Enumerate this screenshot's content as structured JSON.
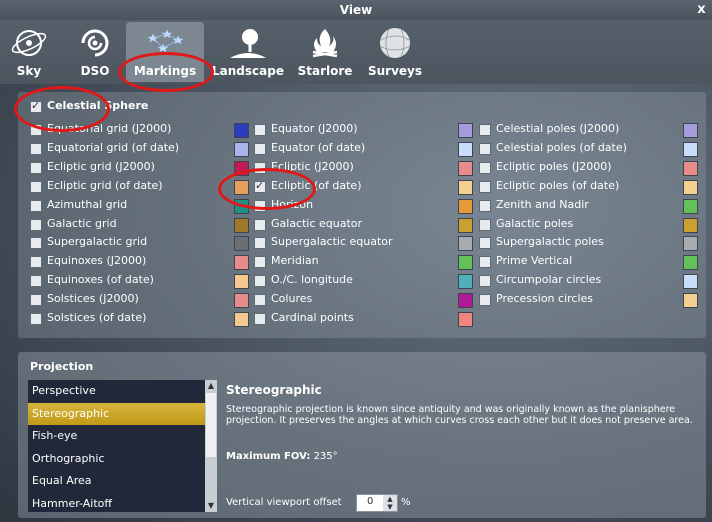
{
  "window": {
    "title": "View",
    "close": "x"
  },
  "tabs": [
    {
      "label": "Sky",
      "icon": "sky-icon"
    },
    {
      "label": "DSO",
      "icon": "dso-icon"
    },
    {
      "label": "Markings",
      "icon": "markings-icon"
    },
    {
      "label": "Landscape",
      "icon": "landscape-icon"
    },
    {
      "label": "Starlore",
      "icon": "starlore-icon"
    },
    {
      "label": "Surveys",
      "icon": "surveys-icon"
    }
  ],
  "active_tab": "Markings",
  "markings": {
    "header": "Celestial Sphere",
    "header_checked": true,
    "col1": [
      {
        "label": "Equatorial grid (J2000)",
        "color": "#2a3bbf"
      },
      {
        "label": "Equatorial grid (of date)",
        "color": "#aab3ea"
      },
      {
        "label": "Ecliptic grid (J2000)",
        "color": "#c21a55"
      },
      {
        "label": "Ecliptic grid (of date)",
        "color": "#e3a05a"
      },
      {
        "label": "Azimuthal grid",
        "color": "#1f8f84"
      },
      {
        "label": "Galactic grid",
        "color": "#a07a2a"
      },
      {
        "label": "Supergalactic grid",
        "color": "#6b6f74"
      },
      {
        "label": "Equinoxes (J2000)",
        "color": "#e88b8b"
      },
      {
        "label": "Equinoxes (of date)",
        "color": "#f3c98f"
      },
      {
        "label": "Solstices (J2000)",
        "color": "#e88b8b"
      },
      {
        "label": "Solstices (of date)",
        "color": "#f3c98f"
      }
    ],
    "col2": [
      {
        "label": "Equator (J2000)",
        "color": "#a79cdb"
      },
      {
        "label": "Equator (of date)",
        "color": "#c9defa"
      },
      {
        "label": "Ecliptic (J2000)",
        "color": "#e88b8b"
      },
      {
        "label": "Ecliptic (of date)",
        "color": "#f3d08f",
        "checked": true
      },
      {
        "label": "Horizon",
        "color": "#e59a3a"
      },
      {
        "label": "Galactic equator",
        "color": "#cba032"
      },
      {
        "label": "Supergalactic equator",
        "color": "#a9acae"
      },
      {
        "label": "Meridian",
        "color": "#64c15a"
      },
      {
        "label": "O./C. longitude",
        "color": "#4fb0b8"
      },
      {
        "label": "Colures",
        "color": "#b01a96"
      },
      {
        "label": "Cardinal points",
        "color": "#f0847f"
      }
    ],
    "col3": [
      {
        "label": "Celestial poles (J2000)",
        "color": "#a79cdb"
      },
      {
        "label": "Celestial poles (of date)",
        "color": "#c9defa"
      },
      {
        "label": "Ecliptic poles (J2000)",
        "color": "#e88b8b"
      },
      {
        "label": "Ecliptic poles (of date)",
        "color": "#f3d08f"
      },
      {
        "label": "Zenith and Nadir",
        "color": "#64c15a"
      },
      {
        "label": "Galactic poles",
        "color": "#cba032"
      },
      {
        "label": "Supergalactic poles",
        "color": "#a9acae"
      },
      {
        "label": "Prime Vertical",
        "color": "#64c15a"
      },
      {
        "label": "Circumpolar circles",
        "color": "#c9defa"
      },
      {
        "label": "Precession circles",
        "color": "#f3d08f"
      }
    ]
  },
  "projection": {
    "title": "Projection",
    "items": [
      "Perspective",
      "Stereographic",
      "Fish-eye",
      "Orthographic",
      "Equal Area",
      "Hammer-Aitoff"
    ],
    "selected": "Stereographic",
    "desc_title": "Stereographic",
    "desc": "Stereographic projection is known since antiquity and was originally known as the planisphere projection. It preserves the angles at which curves cross each other but it does not preserve area.",
    "fov_label": "Maximum FOV:",
    "fov_value": "235°",
    "vvo_label": "Vertical viewport offset",
    "vvo_value": "0",
    "vvo_unit": "%"
  }
}
